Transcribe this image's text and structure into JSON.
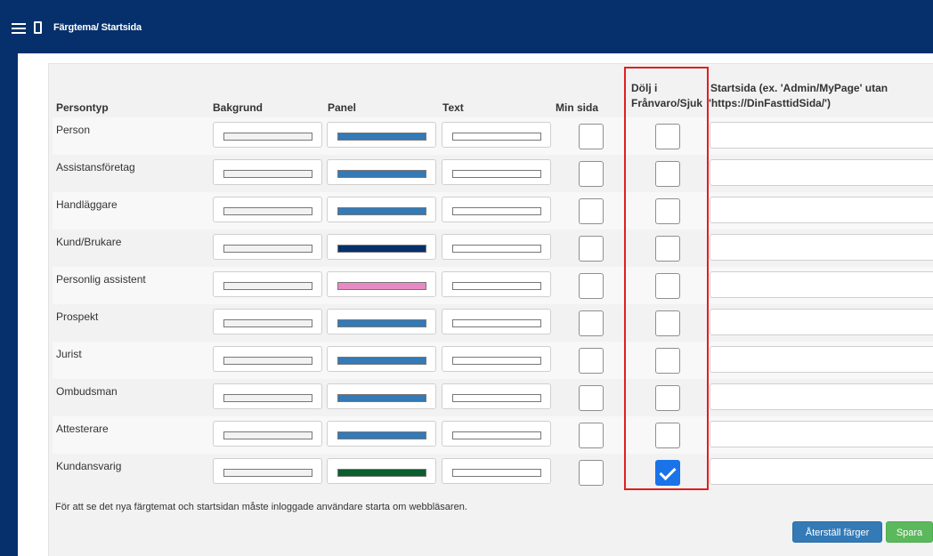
{
  "app": {
    "title": "Färgtema/ Startsida"
  },
  "table": {
    "headers": {
      "persontyp": "Persontyp",
      "bakgrund": "Bakgrund",
      "panel": "Panel",
      "text": "Text",
      "min_sida": "Min sida",
      "dolj_line1": "Dölj i",
      "dolj_line2": "Frånvaro/Sjuk",
      "startsida_line1": "Startsida (ex. 'Admin/MyPage' utan",
      "startsida_line2": "'https://DinFasttidSida/')"
    },
    "rows": [
      {
        "name": "Person",
        "bakgrund": "#f2f2f2",
        "panel": "#337ab7",
        "text": "#ffffff",
        "min_sida": false,
        "dolj": false,
        "startsida": ""
      },
      {
        "name": "Assistansföretag",
        "bakgrund": "#f2f2f2",
        "panel": "#337ab7",
        "text": "#ffffff",
        "min_sida": false,
        "dolj": false,
        "startsida": ""
      },
      {
        "name": "Handläggare",
        "bakgrund": "#f2f2f2",
        "panel": "#337ab7",
        "text": "#ffffff",
        "min_sida": false,
        "dolj": false,
        "startsida": ""
      },
      {
        "name": "Kund/Brukare",
        "bakgrund": "#f2f2f2",
        "panel": "#06306b",
        "text": "#ffffff",
        "min_sida": false,
        "dolj": false,
        "startsida": ""
      },
      {
        "name": "Personlig assistent",
        "bakgrund": "#f2f2f2",
        "panel": "#e78ac3",
        "text": "#ffffff",
        "min_sida": false,
        "dolj": false,
        "startsida": ""
      },
      {
        "name": "Prospekt",
        "bakgrund": "#f2f2f2",
        "panel": "#337ab7",
        "text": "#ffffff",
        "min_sida": false,
        "dolj": false,
        "startsida": ""
      },
      {
        "name": "Jurist",
        "bakgrund": "#f2f2f2",
        "panel": "#337ab7",
        "text": "#ffffff",
        "min_sida": false,
        "dolj": false,
        "startsida": ""
      },
      {
        "name": "Ombudsman",
        "bakgrund": "#f2f2f2",
        "panel": "#337ab7",
        "text": "#ffffff",
        "min_sida": false,
        "dolj": false,
        "startsida": ""
      },
      {
        "name": "Attesterare",
        "bakgrund": "#f2f2f2",
        "panel": "#337ab7",
        "text": "#ffffff",
        "min_sida": false,
        "dolj": false,
        "startsida": ""
      },
      {
        "name": "Kundansvarig",
        "bakgrund": "#f2f2f2",
        "panel": "#0b5e2e",
        "text": "#ffffff",
        "min_sida": false,
        "dolj": true,
        "startsida": ""
      }
    ]
  },
  "note": "För att se det nya färgtemat och startsidan måste inloggade användare starta om webbläsaren.",
  "buttons": {
    "reset": "Återställ färger",
    "save": "Spara"
  },
  "colors": {
    "navbar": "#06306b",
    "highlight_border": "#e11f1f",
    "checkbox_checked": "#1a73e8",
    "primary_button": "#337ab7",
    "success_button": "#5cb85c"
  },
  "icons": {
    "menu": "hamburger-menu-icon",
    "page": "page-icon",
    "check": "checkmark-icon"
  }
}
